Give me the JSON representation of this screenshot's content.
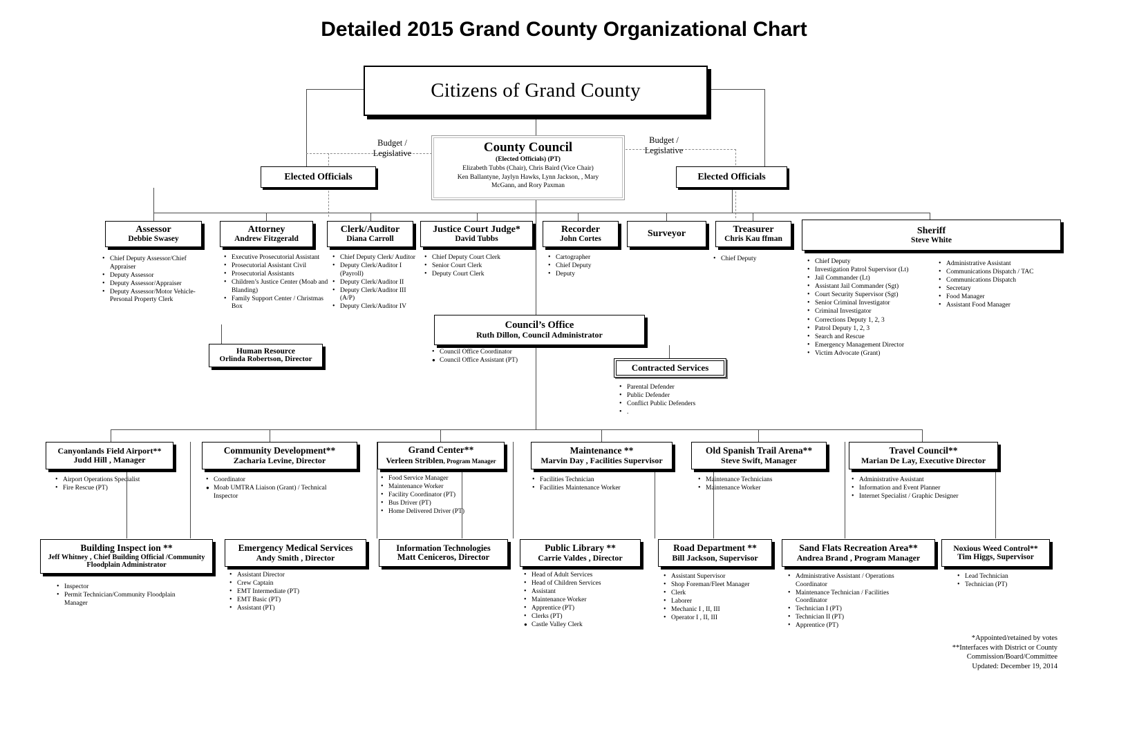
{
  "title": "Detailed 2015 Grand County Organizational Chart",
  "top": {
    "citizens": {
      "name": "Citizens of Grand County"
    },
    "council": {
      "name": "County Council",
      "subtitle": "(Elected Officials) (PT)",
      "members_line1": "Elizabeth Tubbs (Chair), Chris Baird (Vice Chair)",
      "members_line2": "Ken Ballantyne, Jaylyn Hawks, Lynn Jackson, , Mary",
      "members_line3": "McGann, and Rory Paxman"
    },
    "budget_left": "Budget /\nLegislative",
    "budget_right": "Budget /\nLegislative",
    "elected_left": "Elected Officials",
    "elected_right": "Elected Officials"
  },
  "elected_row": [
    {
      "title": "Assessor",
      "person": "Debbie Swasey",
      "reports": [
        "Chief Deputy Assessor/Chief Appraiser",
        "Deputy Assessor",
        "Deputy Assessor/Appraiser",
        "Deputy Assessor/Motor Vehicle-Personal Property Clerk"
      ]
    },
    {
      "title": "Attorney",
      "person": "Andrew Fitzgerald",
      "reports": [
        "Executive Prosecutorial Assistant",
        "Prosecutorial Assistant Civil",
        "Prosecutorial Assistants",
        "Children’s Justice Center (Moab and Blanding)",
        "Family Support Center / Christmas Box"
      ]
    },
    {
      "title": "Clerk/Auditor",
      "person": "Diana Carroll",
      "reports": [
        "Chief Deputy Clerk/ Auditor",
        "Deputy Clerk/Auditor  I (Payroll)",
        "Deputy Clerk/Auditor II",
        "Deputy Clerk/Auditor III  (A/P)",
        "Deputy Clerk/Auditor IV"
      ]
    },
    {
      "title": "Justice Court Judge*",
      "person": "David Tubbs",
      "reports": [
        "Chief Deputy Court Clerk",
        "Senior Court Clerk",
        "Deputy Court Clerk"
      ]
    },
    {
      "title": "Recorder",
      "person": "John Cortes",
      "reports": [
        "Cartographer",
        "Chief Deputy",
        "Deputy"
      ]
    },
    {
      "title": "Surveyor",
      "person": "",
      "reports": []
    },
    {
      "title": "Treasurer",
      "person": "Chris Kau ffman",
      "reports": [
        "Chief Deputy"
      ]
    }
  ],
  "sheriff": {
    "title": "Sheriff",
    "person": "Steve White",
    "reports_col1": [
      "Chief Deputy",
      "Investigation Patrol Supervisor (Lt)",
      "Jail Commander (Lt)",
      "Assistant Jail Commander (Sgt)",
      "Court Security Supervisor (Sgt)",
      "Senior Criminal Investigator",
      "Criminal Investigator",
      "Corrections Deputy 1, 2, 3",
      "Patrol Deputy 1, 2, 3",
      "Search and Rescue",
      "Emergency Management Director",
      "Victim Advocate (Grant)"
    ],
    "reports_col2": [
      "Administrative Assistant",
      "Communications Dispatch / TAC",
      "Communications Dispatch",
      "Secretary",
      "Food Manager",
      "Assistant Food Manager"
    ]
  },
  "human_resource": {
    "title": "Human Resource",
    "person": "Orlinda Robertson, Director"
  },
  "councils_office": {
    "title": "Council’s Office",
    "person": "Ruth Dillon,  Council Administrator",
    "reports": [
      "Council Office Coordinator",
      "Council Office Assistant (PT)"
    ]
  },
  "contracted_services": {
    "title": "Contracted Services",
    "reports": [
      "Parental Defender",
      "Public Defender",
      "Conflict Public Defenders",
      "."
    ]
  },
  "departments_mid": [
    {
      "title": "Canyonlands Field   Airport**",
      "person": "Judd Hill , Manager",
      "reports": [
        "Airport Operations Specialist",
        "Fire Rescue (PT)"
      ]
    },
    {
      "title": "Community Development**",
      "person": "Zacharia Levine,   Director",
      "reports": [
        "Coordinator",
        "Moab UMTRA Liaison (Grant) / Technical Inspector"
      ]
    },
    {
      "title": "Grand Center**",
      "person": "Verleen Striblen",
      "person_suffix": ", Program Manager",
      "reports": [
        "Food Service Manager",
        "Maintenance Worker",
        "Facility Coordinator (PT)",
        "Bus Driver (PT)",
        "Home Delivered Driver (PT)"
      ]
    },
    {
      "title": "Maintenance **",
      "person": "Marvin Day  , Facilities Supervisor",
      "reports": [
        "Facilities  Technician",
        "Facilities Maintenance Worker"
      ]
    },
    {
      "title": "Old Spanish Trail Arena**",
      "person": "Steve Swift,  Manager",
      "reports": [
        "Maintenance Technicians",
        "Maintenance Worker"
      ]
    },
    {
      "title": "Travel Council**",
      "person": "Marian De Lay, Executive Director",
      "reports": [
        "Administrative Assistant",
        "Information and Event Planner",
        "Internet Specialist / Graphic Designer"
      ]
    }
  ],
  "departments_bottom": [
    {
      "title": "Building Inspect ion **",
      "person": "Jeff Whitney , Chief Building Official /Community",
      "person2": "Floodplain Administrator",
      "reports": [
        "Inspector",
        "Permit Technician/Community Floodplain Manager"
      ]
    },
    {
      "title": "Emergency Medical Services",
      "person": "Andy Smith , Director",
      "reports": [
        "Assistant Director",
        "Crew Captain",
        "EMT Intermediate (PT)",
        "EMT Basic (PT)",
        "Assistant (PT)"
      ]
    },
    {
      "title": "Information Technologies",
      "person": "Matt Ceniceros, Director",
      "reports": []
    },
    {
      "title": "Public  Library **",
      "person": "Carrie Valdes , Director",
      "reports": [
        "Head of Adult Services",
        "Head of Children Services",
        "Assistant",
        "Maintenance Worker",
        "Apprentice (PT)",
        "Clerks (PT)",
        "Castle Valley Clerk"
      ]
    },
    {
      "title": "Road Department **",
      "person": "Bill Jackson, Supervisor",
      "reports": [
        "Assistant Supervisor",
        "Shop Foreman/Fleet Manager",
        "Clerk",
        "Laborer",
        "Mechanic I , II, III",
        "Operator I , II, III"
      ]
    },
    {
      "title": "Sand Flats Recreation Area**",
      "person": "Andrea Brand  , Program  Manager",
      "reports": [
        "Administrative Assistant / Operations Coordinator",
        "Maintenance Technician / Facilities Coordinator",
        "Technician  I (PT)",
        "Technician II (PT)",
        "Apprentice (PT)"
      ]
    },
    {
      "title": "Noxious Weed Control**",
      "person": "Tim Higgs, Supervisor",
      "reports": [
        "Lead Technician",
        "Technician (PT)"
      ]
    }
  ],
  "footnotes": {
    "line1": "*Appointed/retained by votes",
    "line2": "**Interfaces with District or County",
    "line3": "Commission/Board/Committee",
    "line4": "Updated: December 19, 2014"
  }
}
